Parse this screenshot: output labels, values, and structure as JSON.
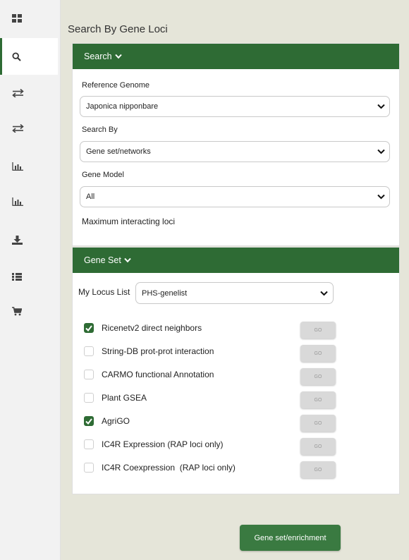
{
  "colors": {
    "brand_green": "#2e6b34",
    "background": "#e5e5d9",
    "sidebar": "#f2f2f2"
  },
  "sidebar": {
    "items": [
      {
        "icon": "dashboard-icon",
        "active": false
      },
      {
        "icon": "search-icon",
        "active": true
      },
      {
        "icon": "transfer-icon",
        "active": false
      },
      {
        "icon": "transfer-icon",
        "active": false
      },
      {
        "icon": "bar-chart-icon",
        "active": false
      },
      {
        "icon": "bar-chart-icon",
        "active": false
      },
      {
        "icon": "download-icon",
        "active": false
      },
      {
        "icon": "list-icon",
        "active": false
      },
      {
        "icon": "cart-icon",
        "active": false
      }
    ]
  },
  "page": {
    "title": "Search By Gene Loci"
  },
  "search_panel": {
    "header": "Search",
    "reference_genome": {
      "label": "Reference Genome",
      "value": "Japonica nipponbare"
    },
    "search_by": {
      "label": "Search By",
      "value": "Gene set/networks"
    },
    "gene_model": {
      "label": "Gene Model",
      "value": "All"
    },
    "max_loci_label": "Maximum interacting loci"
  },
  "gene_set_panel": {
    "header": "Gene Set",
    "locus_list": {
      "label": "My Locus List",
      "value": "PHS-genelist"
    },
    "options": [
      {
        "label": "Ricenetv2 direct neighbors",
        "checked": true,
        "go": "GO"
      },
      {
        "label": "String-DB prot-prot interaction",
        "checked": false,
        "go": "GO"
      },
      {
        "label": "CARMO functional Annotation",
        "checked": false,
        "go": "GO"
      },
      {
        "label": "Plant GSEA",
        "checked": false,
        "go": "GO"
      },
      {
        "label": "AgriGO",
        "checked": true,
        "go": "GO"
      },
      {
        "label": "IC4R Expression (RAP loci only)",
        "checked": false,
        "go": "GO"
      },
      {
        "label": "IC4R Coexpression  (RAP loci only)",
        "checked": false,
        "go": "GO"
      }
    ]
  },
  "submit_button": "Gene set/enrichment"
}
